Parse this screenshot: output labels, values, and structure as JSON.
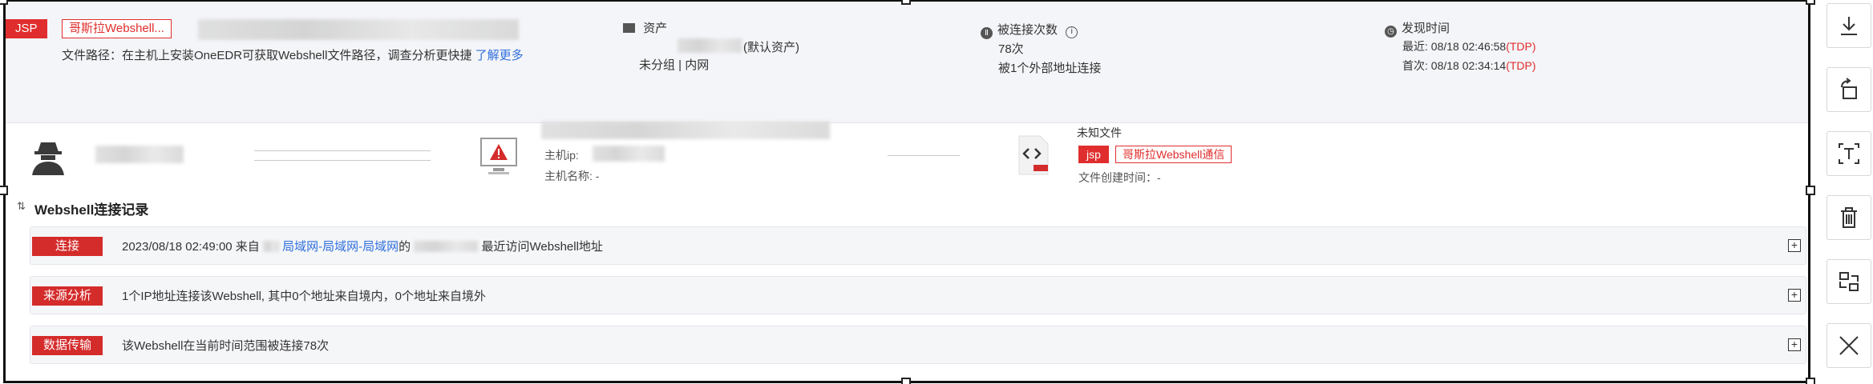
{
  "alert": {
    "type_tag": "JSP",
    "family_tag": "哥斯拉Webshell...",
    "file_path_note": "文件路径：在主机上安装OneEDR可获取Webshell文件路径，调查分析更快捷",
    "learn_more": "了解更多"
  },
  "asset": {
    "label": "资产",
    "group": "(默认资产)",
    "sub": "未分组 | 内网"
  },
  "connections": {
    "label": "被连接次数",
    "count": "78次",
    "external": "被1个外部地址连接"
  },
  "discovery": {
    "label": "发现时间",
    "latest_prefix": "最近: 08/18 02:46:58",
    "latest_suffix": "(TDP)",
    "first_prefix": "首次: 08/18 02:34:14",
    "first_suffix": "(TDP)"
  },
  "flow": {
    "host_ip_label": "主机ip:",
    "host_name_label": "主机名称: -",
    "file_label": "未知文件",
    "file_type_tag": "jsp",
    "file_family_tag": "哥斯拉Webshell通信",
    "file_created": "文件创建时间：-"
  },
  "records": {
    "title": "Webshell连接记录",
    "rows": [
      {
        "label": "连接",
        "time": "2023/08/18 02:49:00 来自",
        "network": "局域网-局域网-局域网",
        "suffix": "最近访问Webshell地址"
      },
      {
        "label": "来源分析",
        "text": "1个IP地址连接该Webshell, 其中0个地址来自境内，0个地址来自境外"
      },
      {
        "label": "数据传输",
        "text": "该Webshell在当前时间范围被连接78次"
      }
    ]
  },
  "colors": {
    "accent_red": "#e02d2d",
    "link_blue": "#2f6fde"
  }
}
